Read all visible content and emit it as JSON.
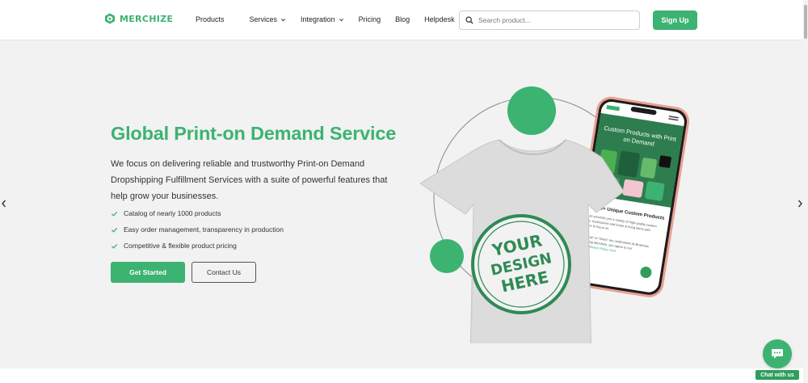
{
  "brand": {
    "name": "MERCHIZE",
    "color": "#3cb371"
  },
  "nav": {
    "items": [
      {
        "label": "Products",
        "dropdown": false
      },
      {
        "label": "Services",
        "dropdown": true
      },
      {
        "label": "Integration",
        "dropdown": true
      },
      {
        "label": "Pricing",
        "dropdown": false
      },
      {
        "label": "Blog",
        "dropdown": false
      },
      {
        "label": "Helpdesk",
        "dropdown": false
      }
    ]
  },
  "search": {
    "placeholder": "Search product...",
    "value": "",
    "icon": "search-icon"
  },
  "header": {
    "signup_label": "Sign Up"
  },
  "hero": {
    "title": "Global Print-on Demand Service",
    "subtitle": "We focus on delivering reliable and trustworthy Print-on Demand Dropshipping Fulfillment Services with a suite of powerful features that help grow your businesses.",
    "features": [
      "Catalog of nearly 1000 products",
      "Easy order management, transparency in production",
      "Competitive & flexible product pricing"
    ],
    "primary_cta": "Get Started",
    "secondary_cta": "Contact Us"
  },
  "illustration": {
    "tshirt_print": [
      "YOUR",
      "DESIGN",
      "HERE"
    ],
    "phone_heading": [
      "Custom Products with Print",
      "on Demand"
    ],
    "phone_section_title": "ll 150+ Unique Custom Products",
    "phone_body": [
      "ze provides you a variety of high-quality custom",
      "s, accessories and home & living items with",
      "ice to focus on.",
      "\"Day\" or \"Days\" are understood as Business",
      "using Merchize, you agree to our",
      "Fulfillment Policy here."
    ]
  },
  "chat": {
    "label": "Chat with us",
    "icon": "chat-icon"
  },
  "colors": {
    "accent": "#3cb371",
    "hero_bg": "#f2f2f2",
    "text": "#333333",
    "phone_frame": "#e8a090"
  }
}
